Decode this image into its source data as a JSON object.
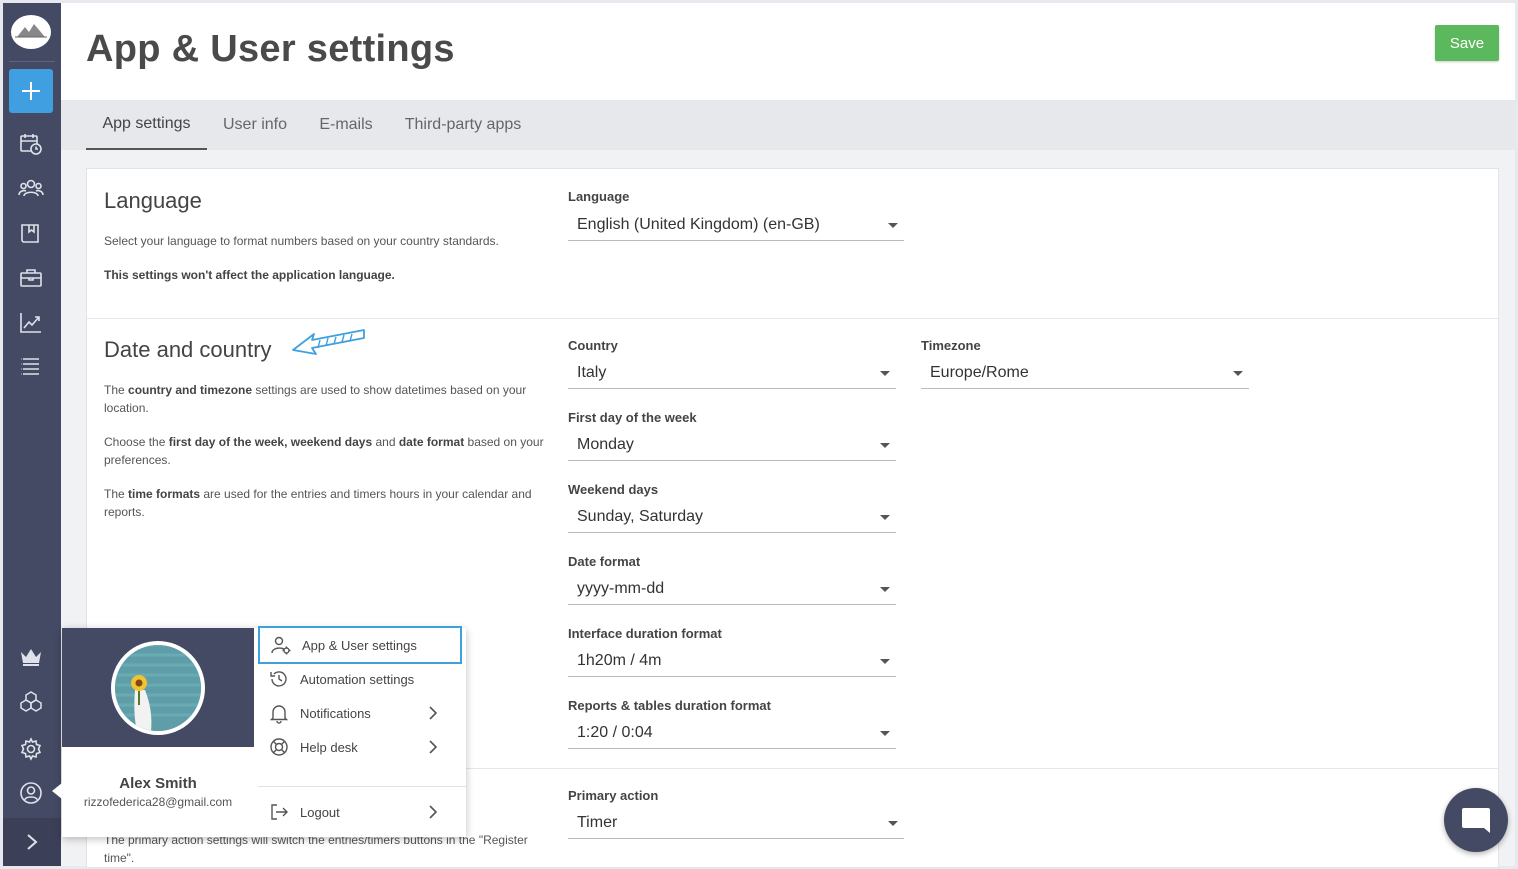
{
  "page": {
    "title": "App & User settings",
    "save_label": "Save"
  },
  "tabs": [
    {
      "label": "App settings"
    },
    {
      "label": "User info"
    },
    {
      "label": "E-mails"
    },
    {
      "label": "Third-party apps"
    }
  ],
  "language": {
    "title": "Language",
    "desc": "Select your language to format numbers based on your country standards.",
    "note": "This settings won't affect the application language.",
    "field_label": "Language",
    "field_value": "English (United Kingdom) (en-GB)"
  },
  "date_country": {
    "title": "Date and country",
    "p1_a": "The ",
    "p1_b": "country and timezone",
    "p1_c": " settings are used to show datetimes based on your location.",
    "p2_a": "Choose the ",
    "p2_b": "first day of the week, weekend days",
    "p2_c": " and ",
    "p2_d": "date format",
    "p2_e": " based on your preferences.",
    "p3_a": "The ",
    "p3_b": "time formats",
    "p3_c": " are used for the entries and timers hours in your calendar and reports.",
    "country_label": "Country",
    "country_value": "Italy",
    "timezone_label": "Timezone",
    "timezone_value": "Europe/Rome",
    "first_day_label": "First day of the week",
    "first_day_value": "Monday",
    "weekend_label": "Weekend days",
    "weekend_value": "Sunday, Saturday",
    "date_format_label": "Date format",
    "date_format_value": "yyyy-mm-dd",
    "interface_duration_label": "Interface duration format",
    "interface_duration_value": "1h20m / 4m",
    "reports_duration_label": "Reports & tables duration format",
    "reports_duration_value": "1:20 / 0:04"
  },
  "primary": {
    "desc": "The primary action settings will switch the entries/timers buttons in the \"Register time\".",
    "field_label": "Primary action",
    "field_value": "Timer"
  },
  "user_menu": {
    "name": "Alex Smith",
    "email": "rizzofederica28@gmail.com",
    "items": [
      {
        "label": "App & User settings"
      },
      {
        "label": "Automation settings"
      },
      {
        "label": "Notifications"
      },
      {
        "label": "Help desk"
      },
      {
        "label": "Logout"
      }
    ]
  },
  "colors": {
    "sidebar": "#444a64",
    "accent": "#3f9fe0",
    "save": "#5cb85c",
    "highlight": "#3fa0dc"
  },
  "icons": [
    "plus-icon",
    "calendar-clock-icon",
    "team-icon",
    "book-icon",
    "briefcase-icon",
    "chart-icon",
    "list-icon",
    "crown-icon",
    "cubes-icon",
    "gear-icon",
    "user-circle-icon",
    "chevron-right-icon",
    "chat-icon"
  ]
}
